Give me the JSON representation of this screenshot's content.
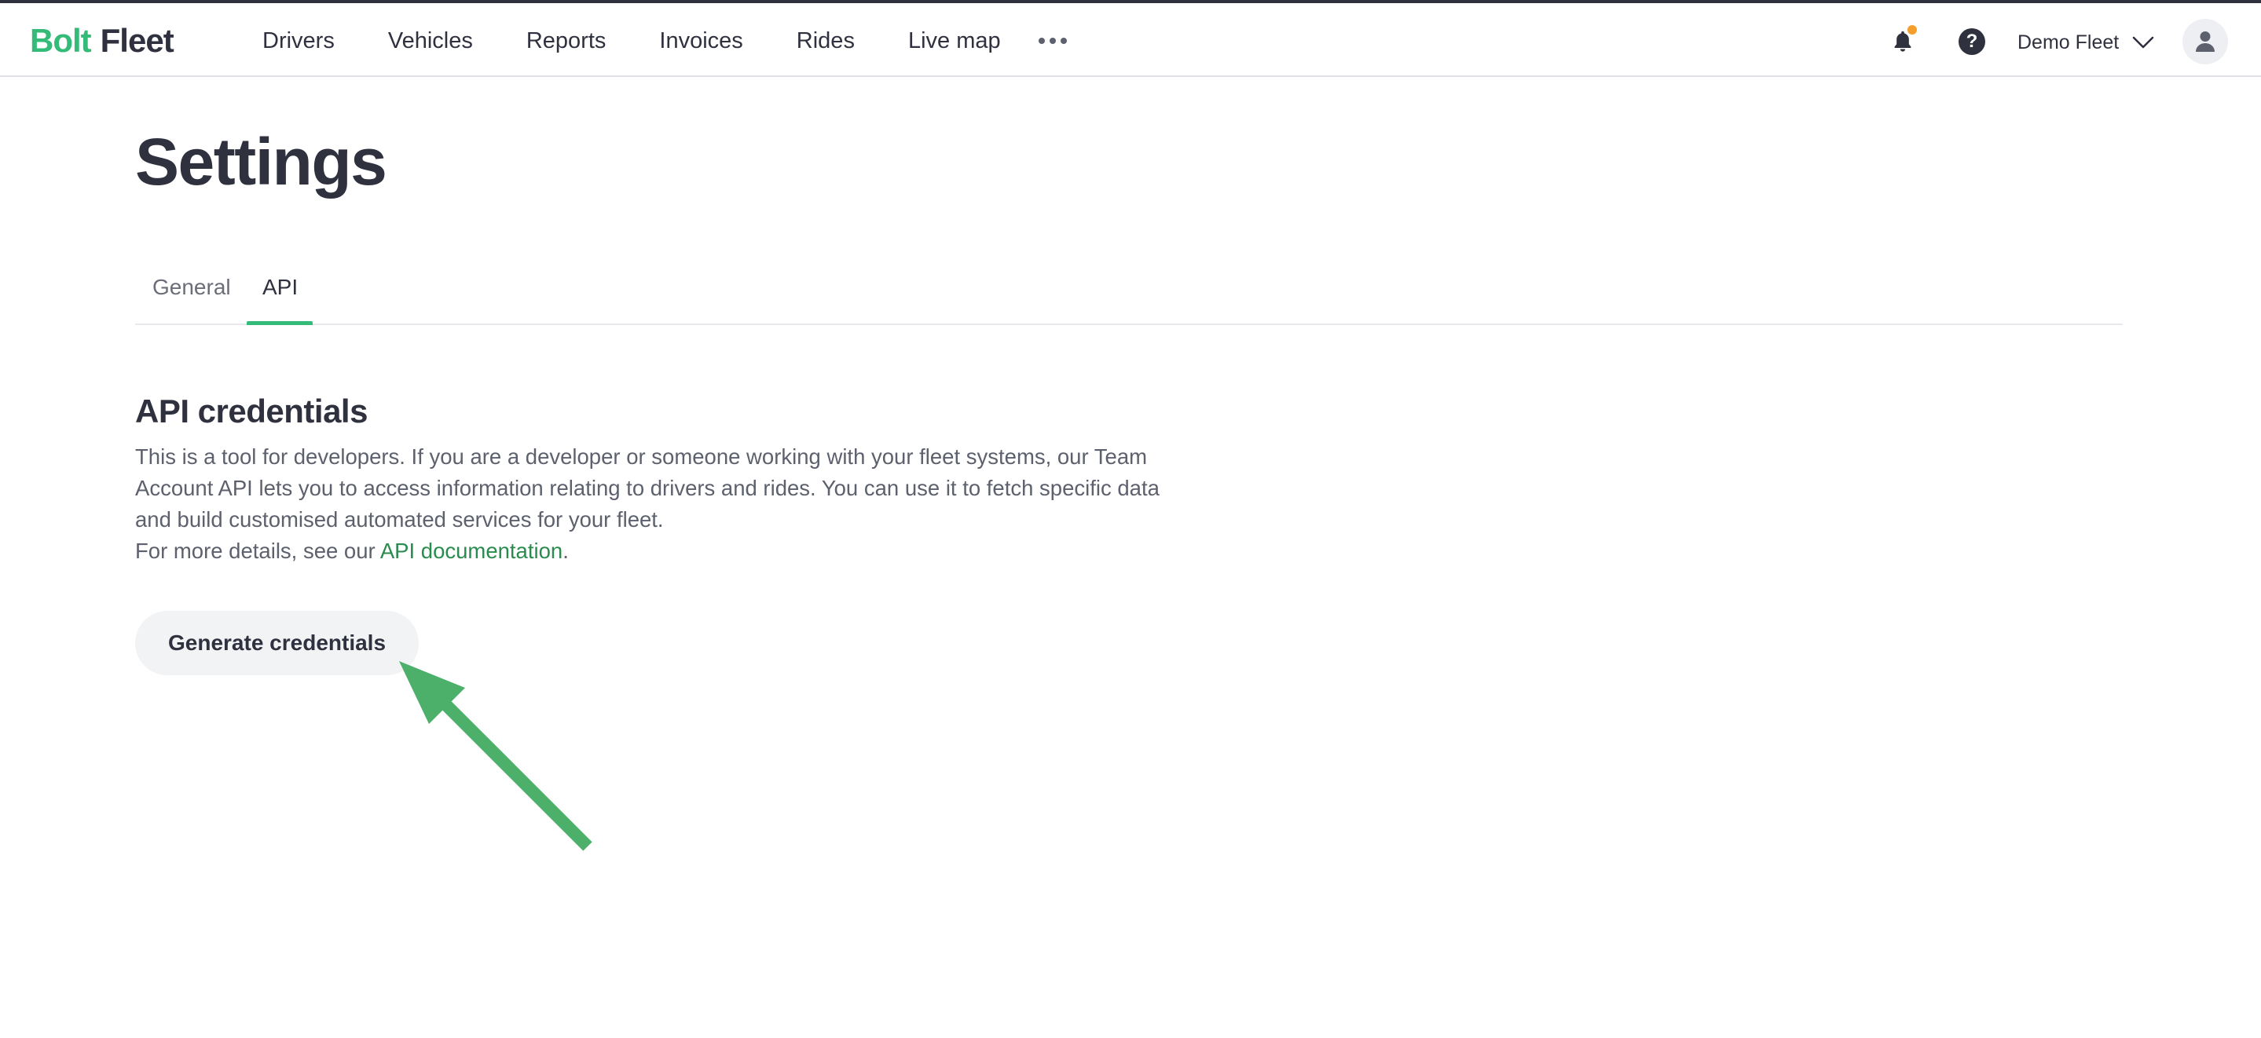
{
  "brand": {
    "logo_part1": "Bolt",
    "logo_part2": "Fleet",
    "accent_color": "#34bb78"
  },
  "nav": {
    "items": [
      {
        "label": "Drivers"
      },
      {
        "label": "Vehicles"
      },
      {
        "label": "Reports"
      },
      {
        "label": "Invoices"
      },
      {
        "label": "Rides"
      },
      {
        "label": "Live map"
      }
    ],
    "more_icon": "more-horizontal-icon",
    "notification_icon": "bell-icon",
    "notification_badge_color": "#f59e2e",
    "help_icon": "question-circle-icon",
    "help_glyph": "?",
    "account_name": "Demo Fleet",
    "account_chevron_icon": "chevron-down-icon",
    "avatar_icon": "user-icon"
  },
  "page": {
    "title": "Settings",
    "tabs": [
      {
        "label": "General",
        "active": false
      },
      {
        "label": "API",
        "active": true
      }
    ]
  },
  "api_section": {
    "title": "API credentials",
    "description_lines": [
      "This is a tool for developers. If you are a developer or someone working with your fleet systems, our Team Account API lets you to access information relating to drivers and rides. You can use it to fetch specific data and build customised automated services for your fleet."
    ],
    "details_prefix": "For more details, see our ",
    "details_link": "API documentation",
    "details_suffix": ".",
    "button_label": "Generate credentials",
    "annotation_arrow_color": "#4caf6a"
  }
}
